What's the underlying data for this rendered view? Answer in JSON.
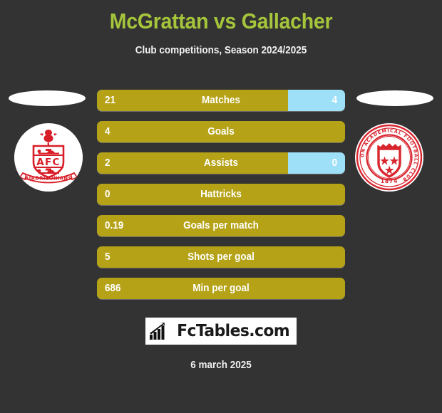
{
  "header": {
    "title": "McGrattan vs Gallacher",
    "subtitle": "Club competitions, Season 2024/2025",
    "title_color": "#a5c63b"
  },
  "teams": {
    "home": {
      "badge_name": "airdrieonians-afc-badge",
      "crest_text": "AFC",
      "ribbon_text": "AIRDRIEONIANS"
    },
    "away": {
      "badge_name": "hamilton-academical-badge",
      "ring_text": "HAMILTON ACADEMICAL FOOTBALL CLUB",
      "founded": "1874"
    }
  },
  "footer": {
    "logo_text": "FcTables.com",
    "logo_icon": "bar-chart-arrow-icon",
    "date": "6 march 2025"
  },
  "colors": {
    "background": "#333333",
    "home_bar": "#b5a216",
    "away_bar": "#9ee0f7",
    "text": "#ffffff"
  },
  "chart_data": {
    "type": "bar",
    "title": "McGrattan vs Gallacher",
    "subtitle": "Club competitions, Season 2024/2025",
    "orientation": "horizontal-paired",
    "legend": [
      "McGrattan",
      "Gallacher"
    ],
    "categories": [
      "Matches",
      "Goals",
      "Assists",
      "Hattricks",
      "Goals per match",
      "Shots per goal",
      "Min per goal"
    ],
    "series": [
      {
        "name": "McGrattan",
        "color": "#b5a216",
        "values": [
          "21",
          "4",
          "2",
          "0",
          "0.19",
          "5",
          "686"
        ]
      },
      {
        "name": "Gallacher",
        "color": "#9ee0f7",
        "values": [
          "4",
          "",
          "0",
          "",
          "",
          "",
          ""
        ]
      }
    ],
    "rows": [
      {
        "label": "Matches",
        "home": "21",
        "away": "4",
        "home_pct": 77,
        "full": false
      },
      {
        "label": "Goals",
        "home": "4",
        "away": "",
        "home_pct": 100,
        "full": true
      },
      {
        "label": "Assists",
        "home": "2",
        "away": "0",
        "home_pct": 77,
        "full": false
      },
      {
        "label": "Hattricks",
        "home": "0",
        "away": "",
        "home_pct": 100,
        "full": true
      },
      {
        "label": "Goals per match",
        "home": "0.19",
        "away": "",
        "home_pct": 100,
        "full": true
      },
      {
        "label": "Shots per goal",
        "home": "5",
        "away": "",
        "home_pct": 100,
        "full": true
      },
      {
        "label": "Min per goal",
        "home": "686",
        "away": "",
        "home_pct": 100,
        "full": true
      }
    ]
  }
}
